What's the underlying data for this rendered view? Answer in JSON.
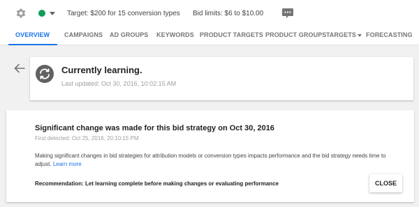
{
  "header": {
    "status_color": "#0f9d58",
    "target": "Target: $200 for 15 conversion types",
    "bid_limits": "Bid limits: $6 to $10.00",
    "icons": [
      "gear-icon",
      "status-dot-icon",
      "chevron-down-icon",
      "chat-icon"
    ]
  },
  "tabs": [
    {
      "label": "OVERVIEW",
      "active": true
    },
    {
      "label": "CAMPAIGNS"
    },
    {
      "label": "AD GROUPS"
    },
    {
      "label": "KEYWORDS"
    },
    {
      "label": "PRODUCT TARGETS"
    },
    {
      "label": "PRODUCT GROUPS"
    },
    {
      "label": "TARGETS"
    },
    {
      "label": "FORECASTING"
    }
  ],
  "accent_color": "#1a73e8",
  "learning": {
    "title": "Currently learning.",
    "last_updated": "Last updated: Oct 30, 2016, 10:02:15 AM"
  },
  "detail": {
    "title": "Significant change was made for this bid strategy on Oct 30, 2016",
    "first_detected": "First detected: Oct 25, 2016, 20:10:15 PM",
    "body": "Making significant changes in bid strategies for attribution models or conversion types impacts performance and the bid strategy needs time to adjust.",
    "learn_more": "Learn more",
    "recommendation": "Recommendation: Let learning complete before making changes or evaluating performance",
    "close_label": "CLOSE"
  }
}
